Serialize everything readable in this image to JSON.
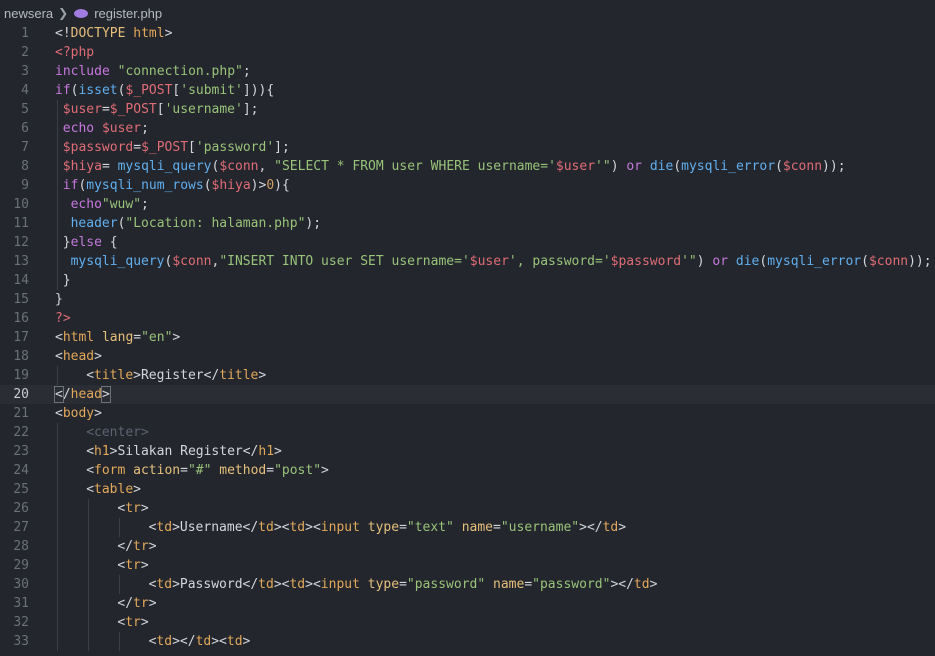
{
  "breadcrumb": {
    "folder": "newsera",
    "file": "register.php"
  },
  "lines": [
    {
      "n": "1",
      "indent": 0,
      "tokens": [
        [
          "p",
          "<!"
        ],
        [
          "a",
          "DOCTYPE"
        ],
        [
          "p",
          " "
        ],
        [
          "t",
          "html"
        ],
        [
          "p",
          ">"
        ]
      ]
    },
    {
      "n": "2",
      "indent": 0,
      "tokens": [
        [
          "m",
          "<?php"
        ]
      ]
    },
    {
      "n": "3",
      "indent": 0,
      "tokens": [
        [
          "k",
          "include"
        ],
        [
          "p",
          " "
        ],
        [
          "s",
          "\"connection.php\""
        ],
        [
          "p",
          ";"
        ]
      ]
    },
    {
      "n": "4",
      "indent": 0,
      "tokens": [
        [
          "k",
          "if"
        ],
        [
          "p",
          "("
        ],
        [
          "f",
          "isset"
        ],
        [
          "p",
          "("
        ],
        [
          "v",
          "$_POST"
        ],
        [
          "p",
          "["
        ],
        [
          "s",
          "'submit'"
        ],
        [
          "p",
          "])){"
        ]
      ]
    },
    {
      "n": "5",
      "indent": 1,
      "tokens": [
        [
          "v",
          "$user"
        ],
        [
          "p",
          "="
        ],
        [
          "v",
          "$_POST"
        ],
        [
          "p",
          "["
        ],
        [
          "s",
          "'username'"
        ],
        [
          "p",
          "];"
        ]
      ]
    },
    {
      "n": "6",
      "indent": 1,
      "tokens": [
        [
          "k",
          "echo"
        ],
        [
          "p",
          " "
        ],
        [
          "v",
          "$user"
        ],
        [
          "p",
          ";"
        ]
      ]
    },
    {
      "n": "7",
      "indent": 1,
      "tokens": [
        [
          "v",
          "$password"
        ],
        [
          "p",
          "="
        ],
        [
          "v",
          "$_POST"
        ],
        [
          "p",
          "["
        ],
        [
          "s",
          "'password'"
        ],
        [
          "p",
          "];"
        ]
      ]
    },
    {
      "n": "8",
      "indent": 1,
      "tokens": [
        [
          "v",
          "$hiya"
        ],
        [
          "p",
          "= "
        ],
        [
          "f",
          "mysqli_query"
        ],
        [
          "p",
          "("
        ],
        [
          "v",
          "$conn"
        ],
        [
          "p",
          ", "
        ],
        [
          "s",
          "\"SELECT * FROM user WHERE username='"
        ],
        [
          "v",
          "$user"
        ],
        [
          "s",
          "'\""
        ],
        [
          "p",
          ") "
        ],
        [
          "k",
          "or"
        ],
        [
          "p",
          " "
        ],
        [
          "f",
          "die"
        ],
        [
          "p",
          "("
        ],
        [
          "f",
          "mysqli_error"
        ],
        [
          "p",
          "("
        ],
        [
          "v",
          "$conn"
        ],
        [
          "p",
          "));"
        ]
      ]
    },
    {
      "n": "9",
      "indent": 1,
      "tokens": [
        [
          "k",
          "if"
        ],
        [
          "p",
          "("
        ],
        [
          "f",
          "mysqli_num_rows"
        ],
        [
          "p",
          "("
        ],
        [
          "v",
          "$hiya"
        ],
        [
          "p",
          ")>"
        ],
        [
          "n",
          "0"
        ],
        [
          "p",
          "){"
        ]
      ]
    },
    {
      "n": "10",
      "indent": 2,
      "tokens": [
        [
          "k",
          "echo"
        ],
        [
          "s",
          "\"wuw\""
        ],
        [
          "p",
          ";"
        ]
      ]
    },
    {
      "n": "11",
      "indent": 2,
      "tokens": [
        [
          "f",
          "header"
        ],
        [
          "p",
          "("
        ],
        [
          "s",
          "\"Location: halaman.php\""
        ],
        [
          "p",
          ");"
        ]
      ]
    },
    {
      "n": "12",
      "indent": 1,
      "tokens": [
        [
          "p",
          "}"
        ],
        [
          "k",
          "else"
        ],
        [
          "p",
          " {"
        ]
      ]
    },
    {
      "n": "13",
      "indent": 2,
      "tokens": [
        [
          "f",
          "mysqli_query"
        ],
        [
          "p",
          "("
        ],
        [
          "v",
          "$conn"
        ],
        [
          "p",
          ","
        ],
        [
          "s",
          "\"INSERT INTO user SET username='"
        ],
        [
          "v",
          "$user"
        ],
        [
          "s",
          "', password='"
        ],
        [
          "v",
          "$password"
        ],
        [
          "s",
          "'\""
        ],
        [
          "p",
          ") "
        ],
        [
          "k",
          "or"
        ],
        [
          "p",
          " "
        ],
        [
          "f",
          "die"
        ],
        [
          "p",
          "("
        ],
        [
          "f",
          "mysqli_error"
        ],
        [
          "p",
          "("
        ],
        [
          "v",
          "$conn"
        ],
        [
          "p",
          "));"
        ]
      ]
    },
    {
      "n": "14",
      "indent": 1,
      "tokens": [
        [
          "p",
          "}"
        ]
      ]
    },
    {
      "n": "15",
      "indent": 0,
      "tokens": [
        [
          "p",
          "}"
        ]
      ]
    },
    {
      "n": "16",
      "indent": 0,
      "tokens": [
        [
          "m",
          "?>"
        ]
      ]
    },
    {
      "n": "17",
      "indent": 0,
      "tokens": [
        [
          "p",
          "<"
        ],
        [
          "t",
          "html"
        ],
        [
          "p",
          " "
        ],
        [
          "a",
          "lang"
        ],
        [
          "p",
          "="
        ],
        [
          "s",
          "\"en\""
        ],
        [
          "p",
          ">"
        ]
      ]
    },
    {
      "n": "18",
      "indent": 0,
      "tokens": [
        [
          "p",
          "<"
        ],
        [
          "t",
          "head"
        ],
        [
          "p",
          ">"
        ]
      ]
    },
    {
      "n": "19",
      "indent": 4,
      "tokens": [
        [
          "p",
          "<"
        ],
        [
          "t",
          "title"
        ],
        [
          "p",
          ">Register</"
        ],
        [
          "t",
          "title"
        ],
        [
          "p",
          ">"
        ]
      ]
    },
    {
      "n": "20",
      "indent": 0,
      "current": true,
      "tokens": [
        [
          "p",
          "<"
        ],
        [
          "p",
          "/"
        ],
        [
          "t",
          "head"
        ],
        [
          "p",
          ">"
        ]
      ]
    },
    {
      "n": "21",
      "indent": 0,
      "tokens": [
        [
          "p",
          "<"
        ],
        [
          "t",
          "body"
        ],
        [
          "p",
          ">"
        ]
      ]
    },
    {
      "n": "22",
      "indent": 4,
      "tokens": [
        [
          "c",
          "<center>"
        ]
      ]
    },
    {
      "n": "23",
      "indent": 4,
      "tokens": [
        [
          "p",
          "<"
        ],
        [
          "t",
          "h1"
        ],
        [
          "p",
          ">Silakan Register</"
        ],
        [
          "t",
          "h1"
        ],
        [
          "p",
          ">"
        ]
      ]
    },
    {
      "n": "24",
      "indent": 4,
      "tokens": [
        [
          "p",
          "<"
        ],
        [
          "t",
          "form"
        ],
        [
          "p",
          " "
        ],
        [
          "a",
          "action"
        ],
        [
          "p",
          "="
        ],
        [
          "s",
          "\"#\""
        ],
        [
          "p",
          " "
        ],
        [
          "a",
          "method"
        ],
        [
          "p",
          "="
        ],
        [
          "s",
          "\"post\""
        ],
        [
          "p",
          ">"
        ]
      ]
    },
    {
      "n": "25",
      "indent": 4,
      "tokens": [
        [
          "p",
          "<"
        ],
        [
          "t",
          "table"
        ],
        [
          "p",
          ">"
        ]
      ]
    },
    {
      "n": "26",
      "indent": 8,
      "tokens": [
        [
          "p",
          "<"
        ],
        [
          "t",
          "tr"
        ],
        [
          "p",
          ">"
        ]
      ]
    },
    {
      "n": "27",
      "indent": 12,
      "tokens": [
        [
          "p",
          "<"
        ],
        [
          "t",
          "td"
        ],
        [
          "p",
          ">Username</"
        ],
        [
          "t",
          "td"
        ],
        [
          "p",
          "><"
        ],
        [
          "t",
          "td"
        ],
        [
          "p",
          "><"
        ],
        [
          "t",
          "input"
        ],
        [
          "p",
          " "
        ],
        [
          "a",
          "type"
        ],
        [
          "p",
          "="
        ],
        [
          "s",
          "\"text\""
        ],
        [
          "p",
          " "
        ],
        [
          "a",
          "name"
        ],
        [
          "p",
          "="
        ],
        [
          "s",
          "\"username\""
        ],
        [
          "p",
          "></"
        ],
        [
          "t",
          "td"
        ],
        [
          "p",
          ">"
        ]
      ]
    },
    {
      "n": "28",
      "indent": 8,
      "tokens": [
        [
          "p",
          "</"
        ],
        [
          "t",
          "tr"
        ],
        [
          "p",
          ">"
        ]
      ]
    },
    {
      "n": "29",
      "indent": 8,
      "tokens": [
        [
          "p",
          "<"
        ],
        [
          "t",
          "tr"
        ],
        [
          "p",
          ">"
        ]
      ]
    },
    {
      "n": "30",
      "indent": 12,
      "tokens": [
        [
          "p",
          "<"
        ],
        [
          "t",
          "td"
        ],
        [
          "p",
          ">Password</"
        ],
        [
          "t",
          "td"
        ],
        [
          "p",
          "><"
        ],
        [
          "t",
          "td"
        ],
        [
          "p",
          "><"
        ],
        [
          "t",
          "input"
        ],
        [
          "p",
          " "
        ],
        [
          "a",
          "type"
        ],
        [
          "p",
          "="
        ],
        [
          "s",
          "\"password\""
        ],
        [
          "p",
          " "
        ],
        [
          "a",
          "name"
        ],
        [
          "p",
          "="
        ],
        [
          "s",
          "\"password\""
        ],
        [
          "p",
          "></"
        ],
        [
          "t",
          "td"
        ],
        [
          "p",
          ">"
        ]
      ]
    },
    {
      "n": "31",
      "indent": 8,
      "tokens": [
        [
          "p",
          "</"
        ],
        [
          "t",
          "tr"
        ],
        [
          "p",
          ">"
        ]
      ]
    },
    {
      "n": "32",
      "indent": 8,
      "tokens": [
        [
          "p",
          "<"
        ],
        [
          "t",
          "tr"
        ],
        [
          "p",
          ">"
        ]
      ]
    },
    {
      "n": "33",
      "indent": 12,
      "tokens": [
        [
          "p",
          "<"
        ],
        [
          "t",
          "td"
        ],
        [
          "p",
          "></"
        ],
        [
          "t",
          "td"
        ],
        [
          "p",
          "><"
        ],
        [
          "t",
          "td"
        ],
        [
          "p",
          ">"
        ]
      ]
    }
  ]
}
